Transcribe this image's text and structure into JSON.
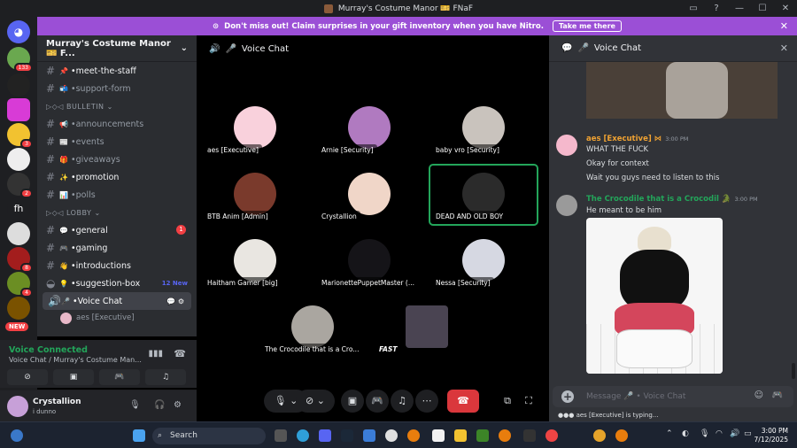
{
  "window": {
    "title": "Murray's Costume Manor 🎫 FNaF"
  },
  "nitro_banner": {
    "text": "Don't miss out! Claim surprises in your gift inventory when you have Nitro.",
    "cta": "Take me there"
  },
  "server_list": {
    "badges": [
      "133",
      "3",
      "2",
      "8",
      "4",
      "4"
    ],
    "new_label": "NEW",
    "fh_label": "fh"
  },
  "sidebar": {
    "server_name": "Murray's Costume Manor 🎫 F...",
    "channels_top": [
      {
        "emoji": "📌",
        "name": "meet-the-staff",
        "bright": true
      },
      {
        "emoji": "📬",
        "name": "support-form",
        "bright": false
      }
    ],
    "cat_bulletin": "▷◇◁ BULLETIN",
    "channels_bulletin": [
      {
        "emoji": "📢",
        "name": "announcements",
        "bright": false
      },
      {
        "emoji": "📰",
        "name": "events",
        "bright": false
      },
      {
        "emoji": "🎁",
        "name": "giveaways",
        "bright": false
      },
      {
        "emoji": "✨",
        "name": "promotion",
        "bright": true
      },
      {
        "emoji": "📊",
        "name": "polls",
        "bright": false
      }
    ],
    "cat_lobby": "▷◇◁ LOBBY",
    "channels_lobby": [
      {
        "emoji": "💬",
        "name": "general",
        "bright": true,
        "unread": "1"
      },
      {
        "emoji": "🎮",
        "name": "gaming",
        "bright": true
      },
      {
        "emoji": "👋",
        "name": "introductions",
        "bright": true
      },
      {
        "emoji": "💡",
        "name": "suggestion-box",
        "bright": true,
        "new": "12 New"
      }
    ],
    "voice_channel": "Voice Chat",
    "voice_user": "aes [Executive]"
  },
  "voice_panel": {
    "status": "Voice Connected",
    "location": "Voice Chat / Murray's Costume Man..."
  },
  "user_panel": {
    "name": "Crystallion",
    "status": "i dunno"
  },
  "stage": {
    "title": "Voice Chat",
    "tiles": [
      {
        "label": "aes [Executive]",
        "bg": "#f5b8cc"
      },
      {
        "label": "Arnie [Security]",
        "bg": "#e8b0c8"
      },
      {
        "label": "baby vro [Security]",
        "bg": "#5b4b4b"
      },
      {
        "label": "BTB Anim [Admin]",
        "bg": "#c8282e"
      },
      {
        "label": "Crystallion",
        "bg": "#6a5197"
      },
      {
        "label": "DEAD AND OLD BOY",
        "bg": "#c98878"
      },
      {
        "label": "Haitham Gamer [big]",
        "bg": "#5d5047"
      },
      {
        "label": "MarionettePuppetMaster (...",
        "bg": "#2c2a33"
      },
      {
        "label": "Nessa [Security]",
        "bg": "#d29aa8"
      },
      {
        "label": "The Crocodile that is a Cro...",
        "bg": "#6b6560"
      },
      {
        "label": "FAST",
        "bg": "#3b3141"
      }
    ]
  },
  "chat": {
    "title": "Voice Chat",
    "messages": [
      {
        "author": "aes [Executive] ⋈",
        "time": "3:00 PM",
        "lines": [
          "WHAT THE FUCK",
          "Okay for context",
          "Wait you guys need to listen to this"
        ]
      },
      {
        "author": "The Crocodile that is a Crocodil 🐊",
        "time": "3:00 PM",
        "lines": [
          "He meant to be him"
        ]
      }
    ],
    "input_placeholder": "Message 🎤 • Voice Chat",
    "typing": "aes [Executive] is typing..."
  },
  "taskbar": {
    "search": "Search",
    "time": "3:00 PM",
    "date": "7/12/2025"
  }
}
